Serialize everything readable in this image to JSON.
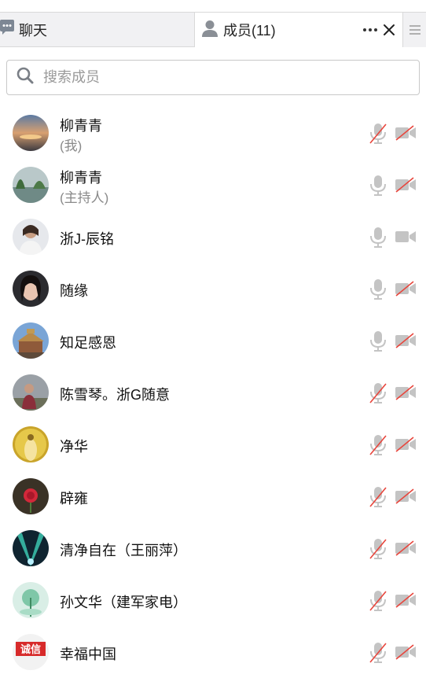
{
  "tabs": {
    "chat_label": "聊天",
    "members_label": "成员(11)"
  },
  "search": {
    "placeholder": "搜索成员"
  },
  "colors": {
    "muted_red": "#e8453c",
    "icon_gray": "#c4c4c4"
  },
  "members": [
    {
      "name": "柳青青",
      "sub": "(我)",
      "mic_muted": true,
      "cam_muted": true
    },
    {
      "name": "柳青青",
      "sub": "(主持人)",
      "mic_muted": false,
      "cam_muted": true
    },
    {
      "name": "浙J-辰铭",
      "sub": "",
      "mic_muted": false,
      "cam_muted": false
    },
    {
      "name": "随缘",
      "sub": "",
      "mic_muted": false,
      "cam_muted": true
    },
    {
      "name": "知足感恩",
      "sub": "",
      "mic_muted": false,
      "cam_muted": true
    },
    {
      "name": "陈雪琴。浙G随意",
      "sub": "",
      "mic_muted": true,
      "cam_muted": true
    },
    {
      "name": "净华",
      "sub": "",
      "mic_muted": true,
      "cam_muted": true
    },
    {
      "name": "辟雍",
      "sub": "",
      "mic_muted": true,
      "cam_muted": true
    },
    {
      "name": "清净自在（王丽萍）",
      "sub": "",
      "mic_muted": true,
      "cam_muted": true
    },
    {
      "name": "孙文华（建军家电）",
      "sub": "",
      "mic_muted": true,
      "cam_muted": true
    },
    {
      "name": "幸福中国",
      "sub": "",
      "mic_muted": true,
      "cam_muted": true,
      "avatar_text": "诚信"
    }
  ]
}
